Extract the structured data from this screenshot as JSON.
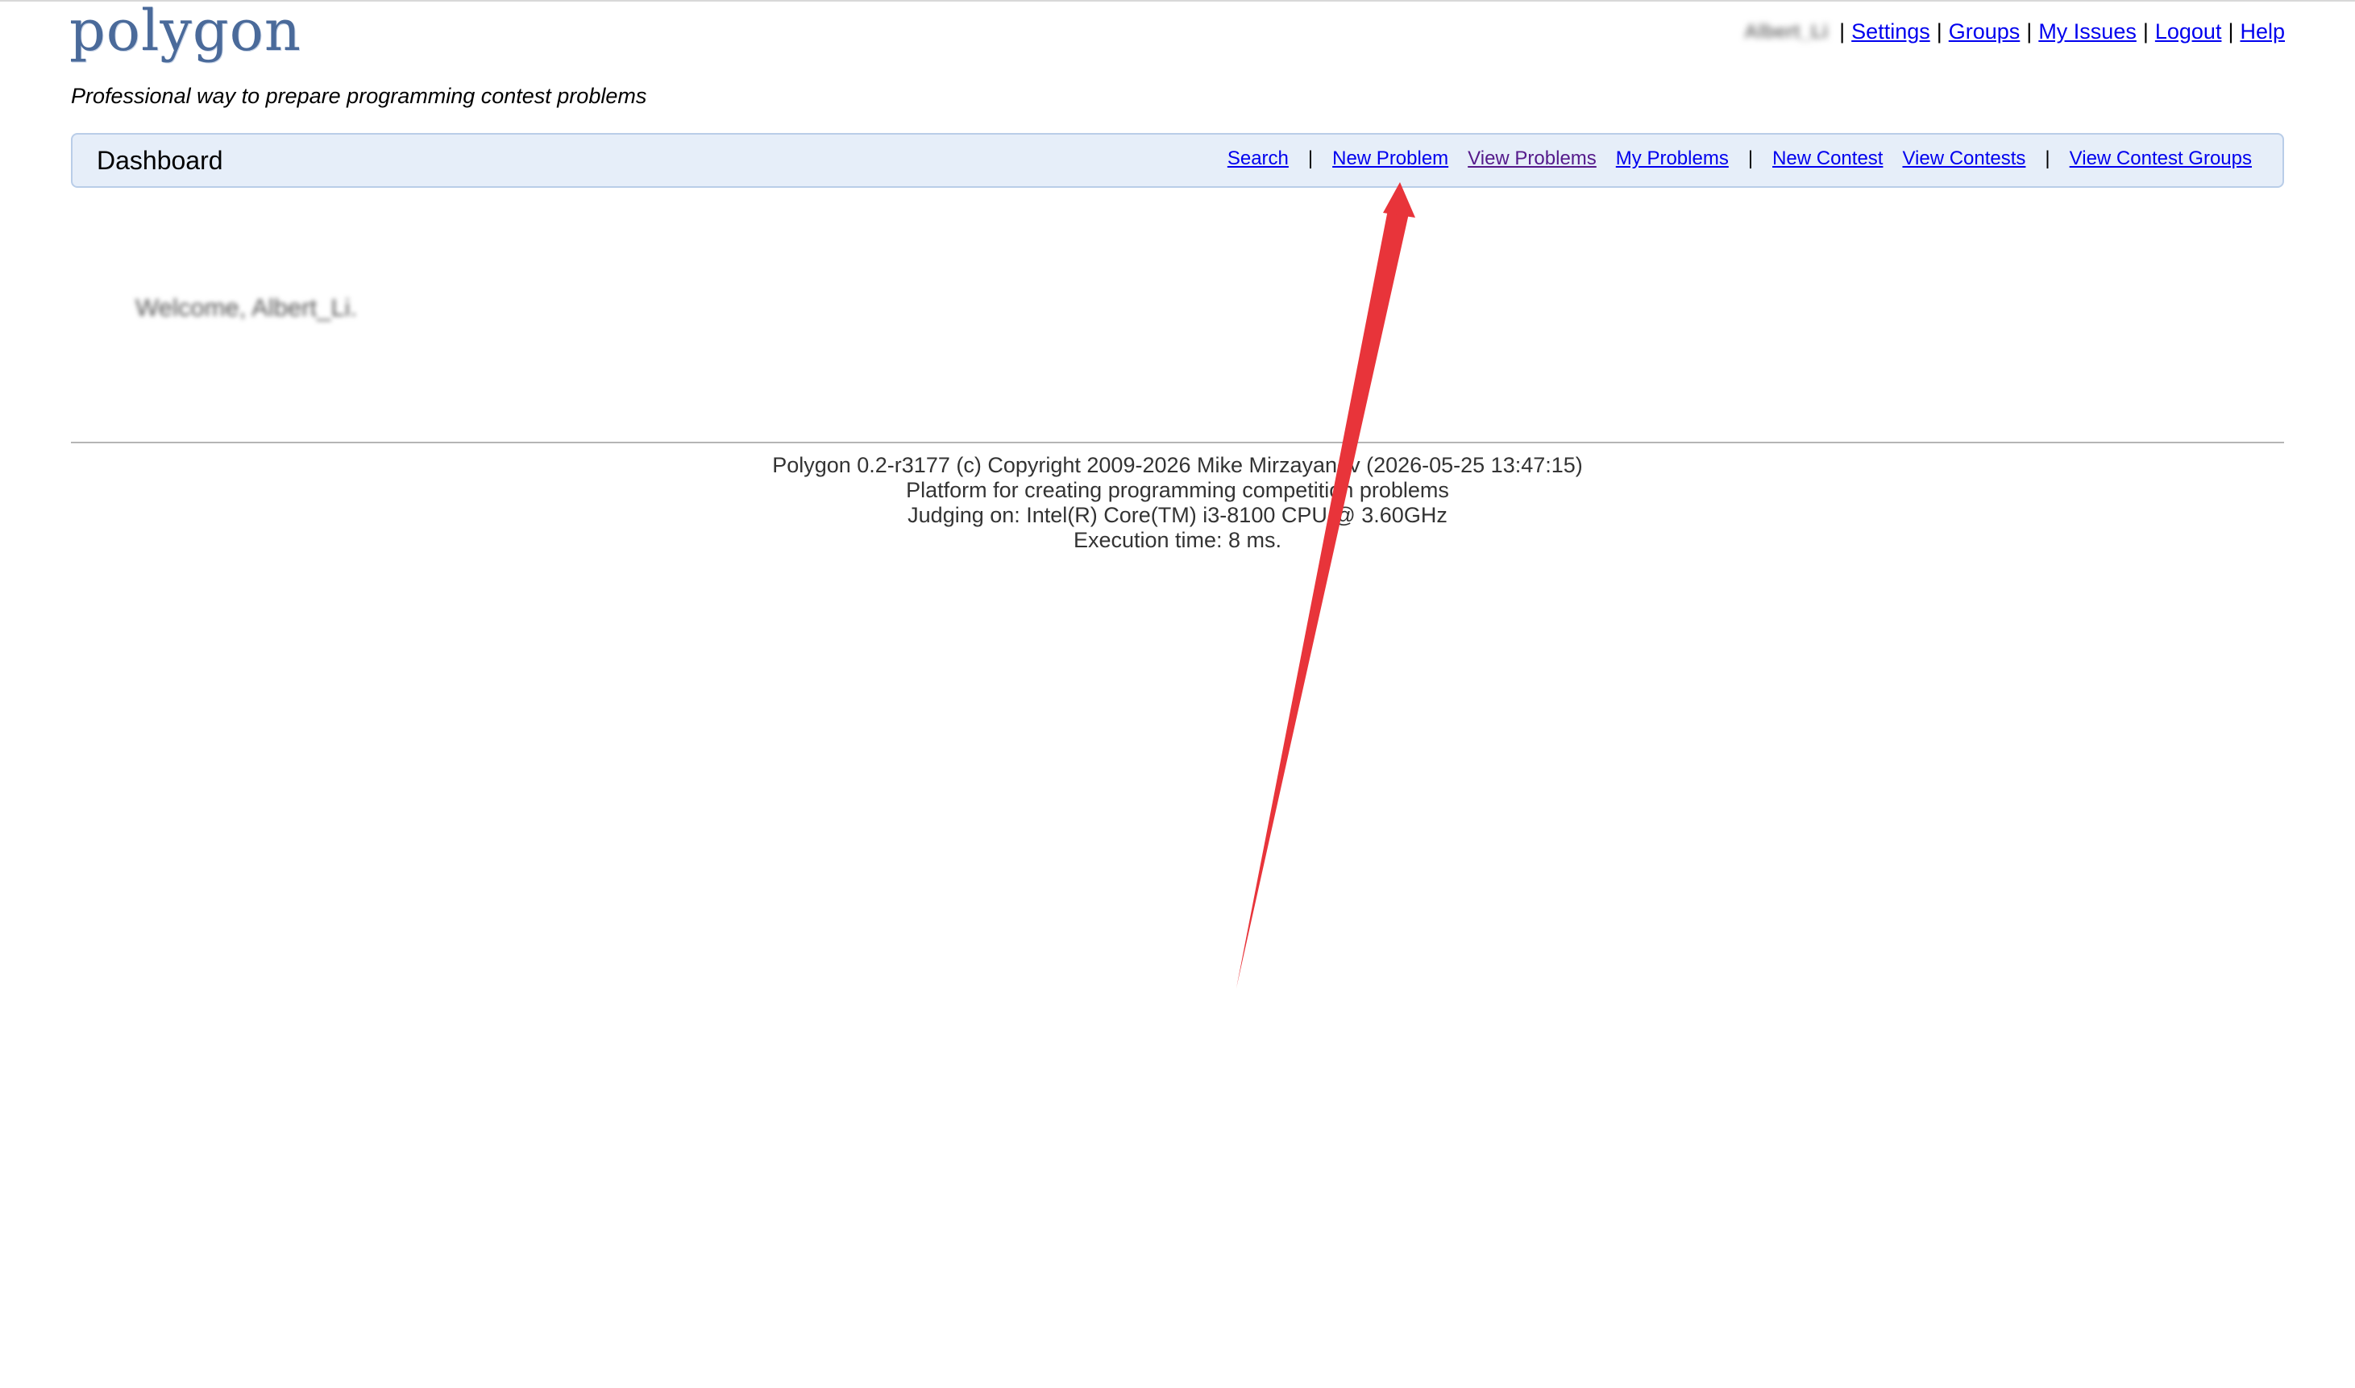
{
  "header": {
    "logo_text": "polygon",
    "tagline": "Professional way to prepare programming contest problems",
    "username": "Albert_Li",
    "links": {
      "settings": "Settings",
      "groups": "Groups",
      "my_issues": "My Issues",
      "logout": "Logout",
      "help": "Help"
    },
    "separator": "|"
  },
  "menu": {
    "title": "Dashboard",
    "items": {
      "search": "Search",
      "new_problem": "New Problem",
      "view_problems": "View Problems",
      "my_problems": "My Problems",
      "new_contest": "New Contest",
      "view_contests": "View Contests",
      "view_contest_groups": "View Contest Groups"
    },
    "separator": "|"
  },
  "main": {
    "welcome": "Welcome, Albert_Li."
  },
  "footer": {
    "line1": "Polygon 0.2-r3177 (c) Copyright 2009-2026 Mike Mirzayanov (2026-05-25 13:47:15)",
    "line2": "Platform for creating programming competition problems",
    "line3": "Judging on: Intel(R) Core(TM) i3-8100 CPU @ 3.60GHz",
    "line4": "Execution time: 8 ms."
  },
  "annotation": {
    "arrow_color": "#e8343a",
    "points_to": "new_problem"
  },
  "colors": {
    "link": "#0000ee",
    "visited_link": "#551a8b",
    "menu_bg": "#e6eef9",
    "menu_border": "#b9cde8",
    "logo": "#4a6a9a"
  }
}
